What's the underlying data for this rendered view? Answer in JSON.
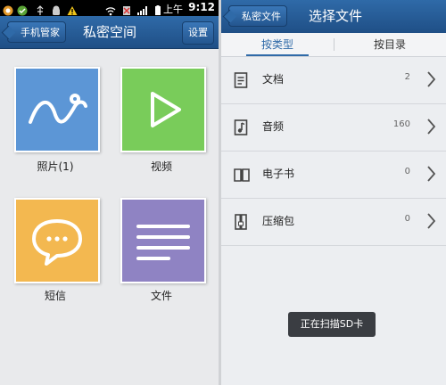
{
  "status_bar": {
    "ampm": "上午",
    "time": "9:12"
  },
  "left": {
    "back_label": "手机管家",
    "title": "私密空间",
    "settings_label": "设置",
    "tiles": [
      {
        "label": "照片(1)",
        "color": "#5c96d6",
        "icon": "landscape-icon"
      },
      {
        "label": "视频",
        "color": "#79cc5a",
        "icon": "play-icon"
      },
      {
        "label": "短信",
        "color": "#f3b850",
        "icon": "chat-bubble-icon"
      },
      {
        "label": "文件",
        "color": "#8f83c3",
        "icon": "text-lines-icon"
      }
    ]
  },
  "right": {
    "back_label": "私密文件",
    "title": "选择文件",
    "tabs": [
      {
        "label": "按类型",
        "active": true
      },
      {
        "label": "按目录",
        "active": false
      }
    ],
    "rows": [
      {
        "label": "文档",
        "count": "2",
        "icon": "document-icon"
      },
      {
        "label": "音频",
        "count": "160",
        "icon": "music-note-icon"
      },
      {
        "label": "电子书",
        "count": "0",
        "icon": "book-icon"
      },
      {
        "label": "压缩包",
        "count": "0",
        "icon": "archive-icon"
      }
    ],
    "toast": "正在扫描SD卡"
  },
  "colors": {
    "accent": "#2f6aa8",
    "titlebar": "#24568f"
  }
}
